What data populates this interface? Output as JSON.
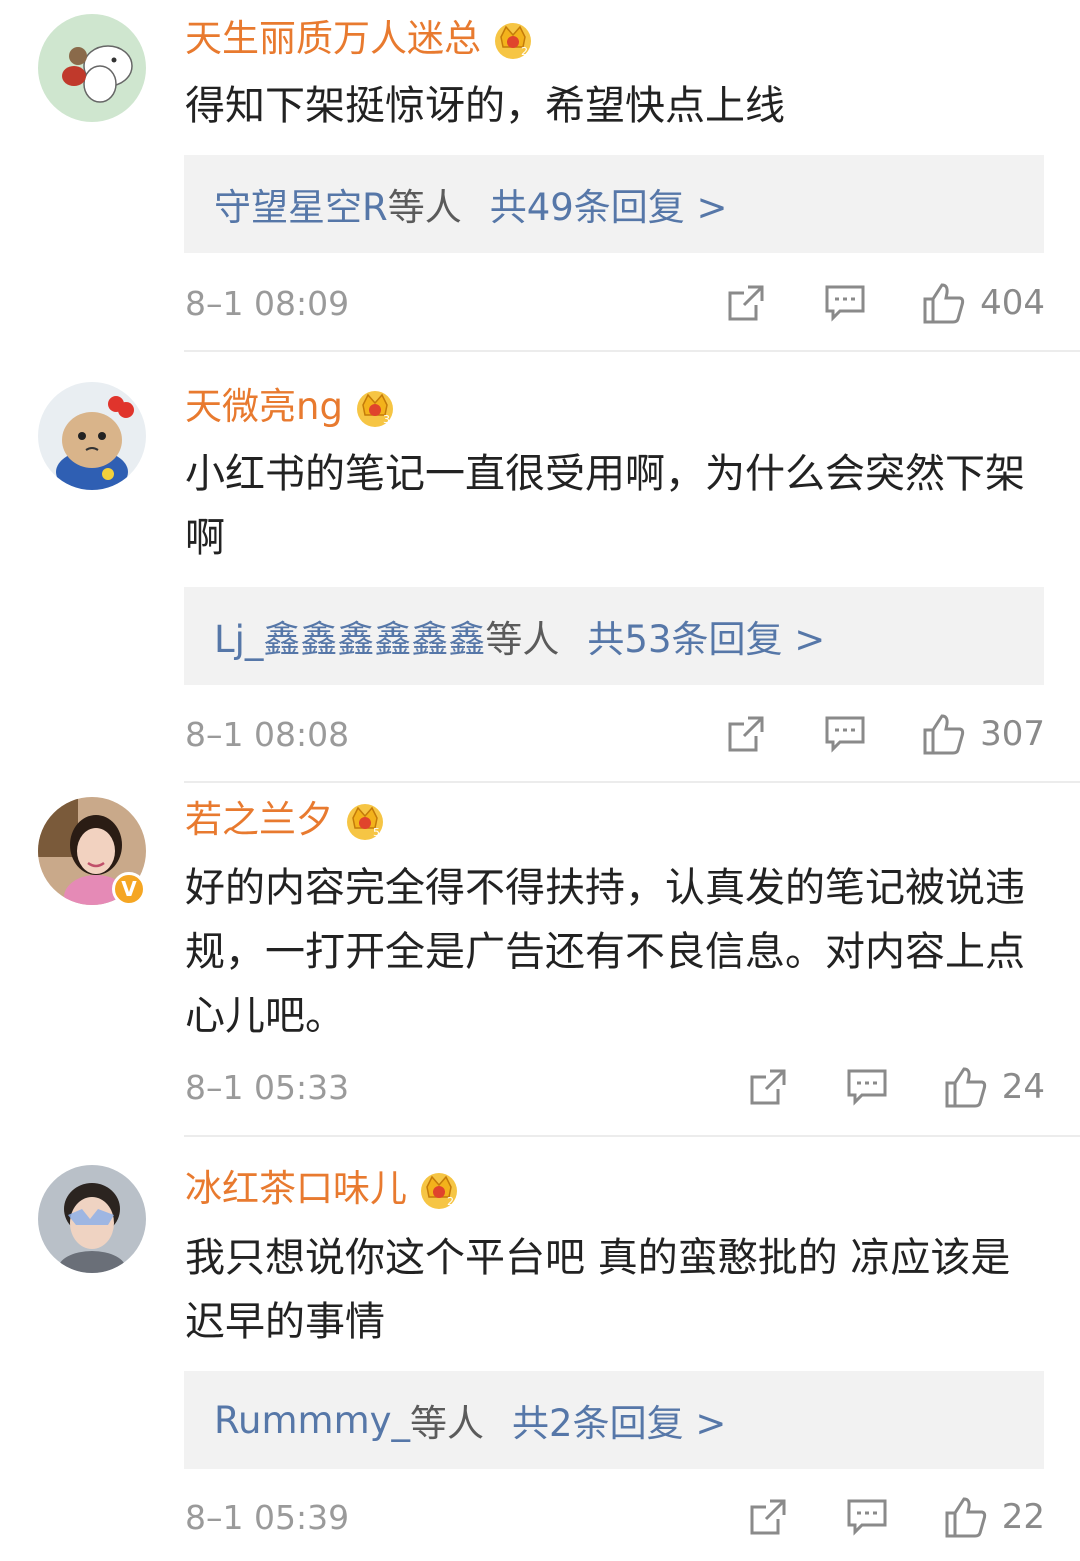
{
  "colors": {
    "username": "#e87a2f",
    "link": "#5677a8",
    "meta": "#9a9a9a",
    "reply_bg": "#f2f2f2"
  },
  "comments": [
    {
      "username": "天生丽质万人迷总",
      "crown_level": "2",
      "text": "得知下架挺惊讶的，希望快点上线",
      "reply_users": "守望星空R",
      "reply_suffix": "等人",
      "reply_count": "共49条回复 >",
      "timestamp": "8–1 08:09",
      "likes": "404",
      "avatar_icon": "moomin-avatar-icon"
    },
    {
      "username": "天微亮ng",
      "crown_level": "3",
      "text": "小红书的笔记一直很受用啊，为什么会突然下架啊",
      "reply_users": "Lj_鑫鑫鑫鑫鑫鑫",
      "reply_suffix": "等人",
      "reply_count": "共53条回复 >",
      "timestamp": "8–1 08:08",
      "likes": "307",
      "avatar_icon": "cat-avatar-icon"
    },
    {
      "username": "若之兰夕",
      "crown_level": "5",
      "text": "好的内容完全得不得扶持，认真发的笔记被说违规，一打开全是广告还有不良信息。对内容上点心儿吧。",
      "timestamp": "8–1 05:33",
      "likes": "24",
      "avatar_icon": "woman-avatar-icon",
      "verified": "V"
    },
    {
      "username": "冰红茶口味儿",
      "crown_level": "2",
      "text": "我只想说你这个平台吧 真的蛮憨批的 凉应该是迟早的事情",
      "reply_users": "Rummmy_",
      "reply_suffix": "等人",
      "reply_count": "共2条回复 >",
      "timestamp": "8–1 05:39",
      "likes": "22",
      "avatar_icon": "boy-avatar-icon"
    }
  ]
}
